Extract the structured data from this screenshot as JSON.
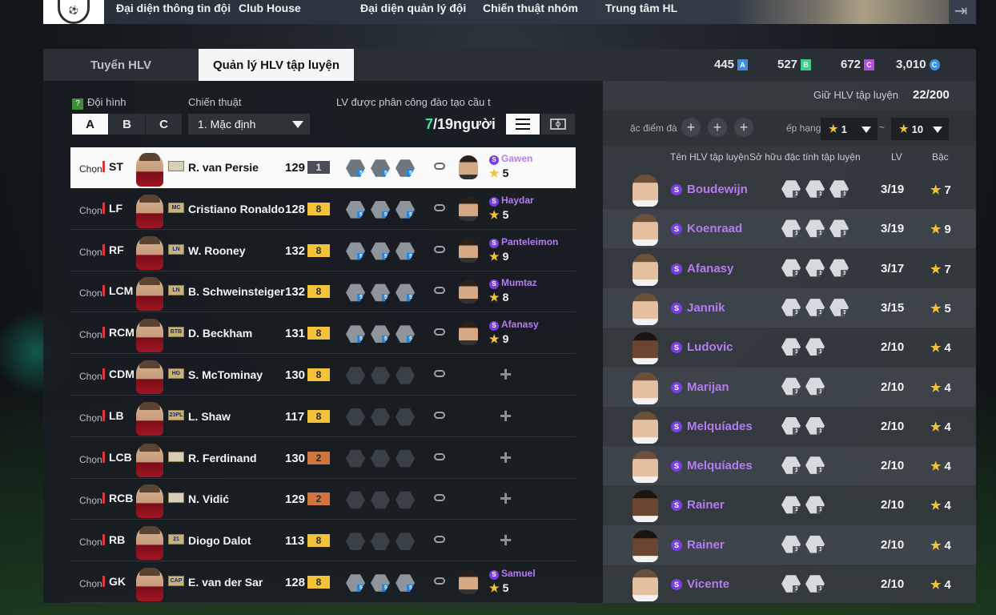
{
  "nav": {
    "items": [
      "Đại diện thông tin đội",
      "Club House",
      "Đại diện quản lý đội",
      "Chiến thuật nhóm",
      "Trung tâm HL"
    ]
  },
  "tabs": {
    "recruit": "Tuyển HLV",
    "manage": "Quản lý HLV tập luyện"
  },
  "currencies": [
    {
      "value": "445",
      "color": "#3a8fe0",
      "letter": "A"
    },
    {
      "value": "527",
      "color": "#3ad08a",
      "letter": "B"
    },
    {
      "value": "672",
      "color": "#b04fe0",
      "letter": "C"
    },
    {
      "value": "3,010",
      "color": "#3a8fe0",
      "letter": "C"
    }
  ],
  "left": {
    "formation_label": "Đội hình",
    "tactic_label": "Chiến thuật",
    "assigned_label": "LV được phân công đào tạo cầu thủ",
    "formations": [
      "A",
      "B",
      "C"
    ],
    "tactic_value": "1. Mặc định",
    "count_current": "7",
    "count_total": "/19người",
    "select_label": "Chọn"
  },
  "players": [
    {
      "pos": "ST",
      "season": "",
      "name": "R. van Persie",
      "ovr": "129",
      "lvl": "1",
      "lvl_color": "grey",
      "hexes": 5,
      "coach": "Gawen",
      "stars": "5",
      "selected": true
    },
    {
      "pos": "LF",
      "season": "MC",
      "name": "Cristiano Ronaldo",
      "ovr": "128",
      "lvl": "8",
      "lvl_color": "gold",
      "hexes": 5,
      "coach": "Haydar",
      "stars": "5"
    },
    {
      "pos": "RF",
      "season": "LN",
      "name": "W. Rooney",
      "ovr": "132",
      "lvl": "8",
      "lvl_color": "gold",
      "hexes": 5,
      "coach": "Panteleimon",
      "stars": "9"
    },
    {
      "pos": "LCM",
      "season": "LN",
      "name": "B. Schweinsteiger",
      "ovr": "132",
      "lvl": "8",
      "lvl_color": "gold",
      "hexes": 5,
      "coach": "Mumtaz",
      "stars": "8"
    },
    {
      "pos": "RCM",
      "season": "BTB",
      "name": "D. Beckham",
      "ovr": "131",
      "lvl": "8",
      "lvl_color": "gold",
      "hexes": 5,
      "coach": "Afanasy",
      "stars": "9"
    },
    {
      "pos": "CDM",
      "season": "HG",
      "name": "S. McTominay",
      "ovr": "130",
      "lvl": "8",
      "lvl_color": "gold",
      "hexes": 0,
      "coach": "",
      "stars": ""
    },
    {
      "pos": "LB",
      "season": "23PL",
      "name": "L. Shaw",
      "ovr": "117",
      "lvl": "8",
      "lvl_color": "gold",
      "hexes": 0,
      "coach": "",
      "stars": ""
    },
    {
      "pos": "LCB",
      "season": "",
      "name": "R. Ferdinand",
      "ovr": "130",
      "lvl": "2",
      "lvl_color": "bronze",
      "hexes": 0,
      "coach": "",
      "stars": ""
    },
    {
      "pos": "RCB",
      "season": "",
      "name": "N. Vidić",
      "ovr": "129",
      "lvl": "2",
      "lvl_color": "bronze",
      "hexes": 0,
      "coach": "",
      "stars": ""
    },
    {
      "pos": "RB",
      "season": "21",
      "name": "Diogo Dalot",
      "ovr": "113",
      "lvl": "8",
      "lvl_color": "gold",
      "hexes": 0,
      "coach": "",
      "stars": ""
    },
    {
      "pos": "GK",
      "season": "CAP",
      "name": "E. van der Sar",
      "ovr": "128",
      "lvl": "8",
      "lvl_color": "gold",
      "hexes": 5,
      "coach": "Samuel",
      "stars": "5"
    }
  ],
  "right": {
    "keep_label": "Giữ HLV tập luyện",
    "keep_value": "22/200",
    "trait_label": "ặc điểm đà",
    "sort_label": "ếp hạng",
    "min_star": "1",
    "tilde": "~",
    "max_star": "10",
    "headers": {
      "name": "Tên HLV tập luyện",
      "traits": "Sở hữu đặc tính tập luyện",
      "lv": "LV",
      "grade": "Bậc"
    }
  },
  "coaches": [
    {
      "name": "Boudewijn",
      "lv": "3/19",
      "grade": "7",
      "skin": "light"
    },
    {
      "name": "Koenraad",
      "lv": "3/19",
      "grade": "9",
      "skin": "light"
    },
    {
      "name": "Afanasy",
      "lv": "3/17",
      "grade": "7",
      "skin": "light"
    },
    {
      "name": "Jannik",
      "lv": "3/15",
      "grade": "5",
      "skin": "light"
    },
    {
      "name": "Ludovic",
      "lv": "2/10",
      "grade": "4",
      "skin": "dark"
    },
    {
      "name": "Marijan",
      "lv": "2/10",
      "grade": "4",
      "skin": "light"
    },
    {
      "name": "Melquíades",
      "lv": "2/10",
      "grade": "4",
      "skin": "light"
    },
    {
      "name": "Melquíades",
      "lv": "2/10",
      "grade": "4",
      "skin": "light"
    },
    {
      "name": "Rainer",
      "lv": "2/10",
      "grade": "4",
      "skin": "dark"
    },
    {
      "name": "Rainer",
      "lv": "2/10",
      "grade": "4",
      "skin": "dark"
    },
    {
      "name": "Vicente",
      "lv": "2/10",
      "grade": "4",
      "skin": "light"
    }
  ],
  "coach_hex_counts": [
    3,
    3,
    3,
    3,
    2,
    2,
    2,
    2,
    2,
    2,
    2
  ]
}
